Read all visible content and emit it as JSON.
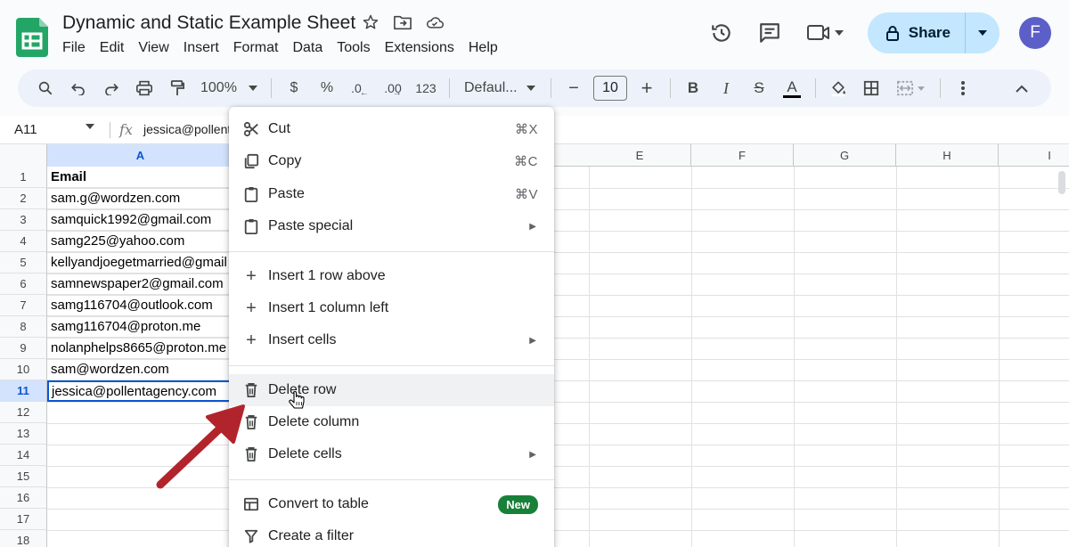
{
  "doc": {
    "title": "Dynamic and Static Example Sheet",
    "menus": [
      "File",
      "Edit",
      "View",
      "Insert",
      "Format",
      "Data",
      "Tools",
      "Extensions",
      "Help"
    ]
  },
  "header": {
    "share_label": "Share",
    "avatar_letter": "F"
  },
  "toolbar": {
    "zoom": "100%",
    "currency": "$",
    "percent": "%",
    "dec_decrease": ".0",
    "dec_increase": ".00",
    "number_format": "123",
    "font": "Defaul...",
    "font_size": "10",
    "minus": "−",
    "plus": "+",
    "bold": "B",
    "italic": "I",
    "strike": "S",
    "text_color": "A"
  },
  "formula_bar": {
    "cell_ref": "A11",
    "fx": "fx",
    "value": "jessica@pollent"
  },
  "grid": {
    "columns": [
      "A",
      "E",
      "F",
      "G",
      "H",
      "I"
    ],
    "rows": [
      "1",
      "2",
      "3",
      "4",
      "5",
      "6",
      "7",
      "8",
      "9",
      "10",
      "11",
      "12",
      "13",
      "14",
      "15",
      "16",
      "17",
      "18"
    ],
    "colA": [
      "Email",
      "sam.g@wordzen.com",
      "samquick1992@gmail.com",
      "samg225@yahoo.com",
      "kellyandjoegetmarried@gmail",
      "samnewspaper2@gmail.com",
      "samg116704@outlook.com",
      "samg116704@proton.me",
      "nolanphelps8665@proton.me",
      "sam@wordzen.com",
      "jessica@pollentagency.com"
    ]
  },
  "context_menu": {
    "cut": "Cut",
    "cut_key": "⌘X",
    "copy": "Copy",
    "copy_key": "⌘C",
    "paste": "Paste",
    "paste_key": "⌘V",
    "paste_special": "Paste special",
    "insert_row": "Insert 1 row above",
    "insert_col": "Insert 1 column left",
    "insert_cells": "Insert cells",
    "delete_row": "Delete row",
    "delete_col": "Delete column",
    "delete_cells": "Delete cells",
    "convert_table": "Convert to table",
    "new_badge": "New",
    "create_filter": "Create a filter"
  },
  "colors": {
    "accent": "#0b57d0",
    "share_bg": "#c2e7ff",
    "arrow": "#b2242c",
    "badge": "#188038"
  }
}
